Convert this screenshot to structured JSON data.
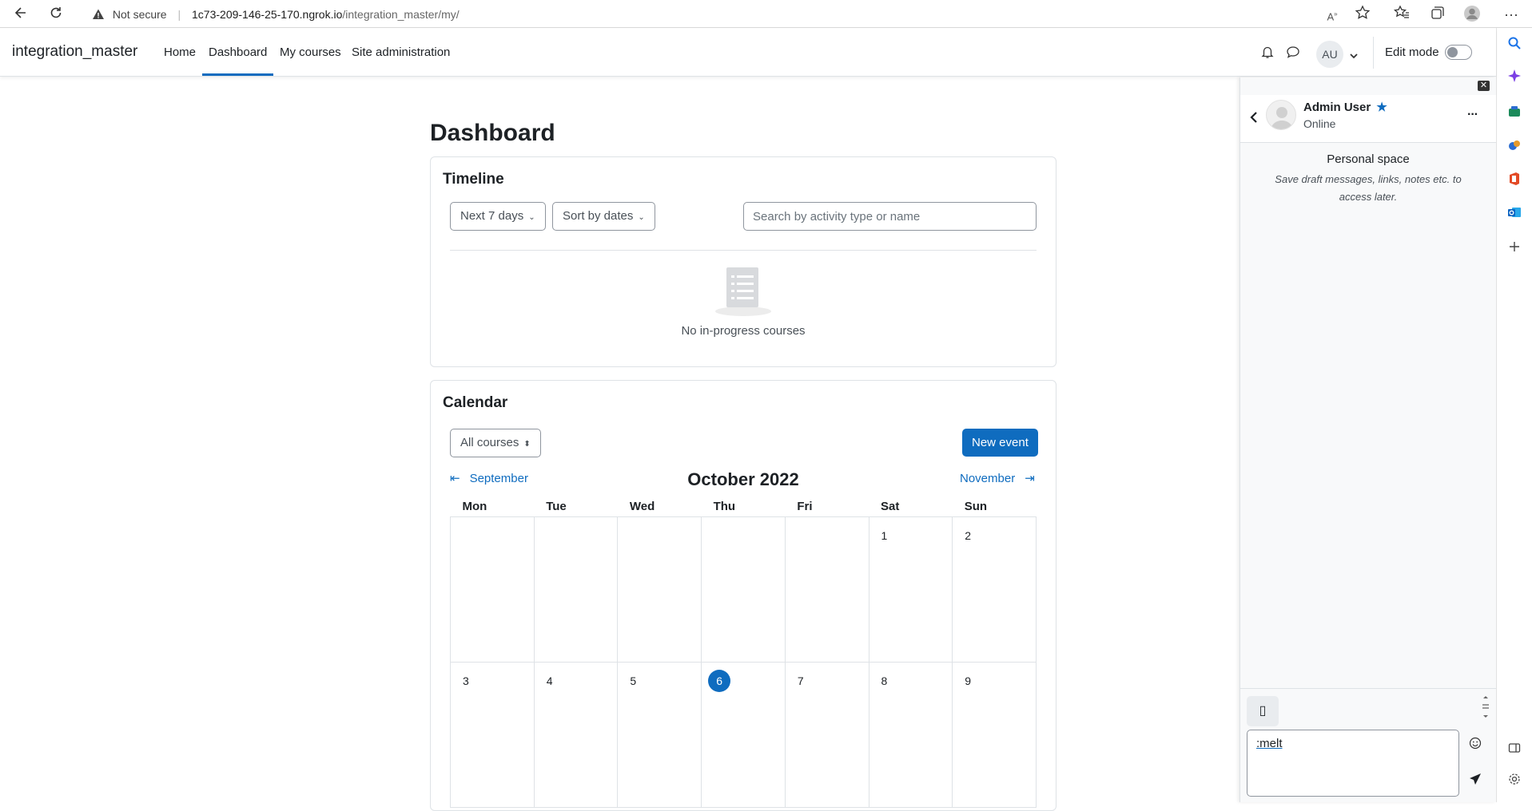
{
  "browser": {
    "not_secure": "Not secure",
    "url_host": "1c73-209-146-25-170.ngrok.io",
    "url_path": "/integration_master/my/"
  },
  "navbar": {
    "brand": "integration_master",
    "links": [
      "Home",
      "Dashboard",
      "My courses",
      "Site administration"
    ],
    "avatar_initials": "AU",
    "edit_mode_label": "Edit mode"
  },
  "main": {
    "page_title": "Dashboard",
    "timeline": {
      "title": "Timeline",
      "filter_label": "Next 7 days",
      "sort_label": "Sort by dates",
      "search_placeholder": "Search by activity type or name",
      "empty_text": "No in-progress courses"
    },
    "calendar": {
      "title": "Calendar",
      "course_select": "All courses",
      "new_event_label": "New event",
      "prev_month": "September",
      "next_month": "November",
      "month_title": "October 2022",
      "weekdays": [
        "Mon",
        "Tue",
        "Wed",
        "Thu",
        "Fri",
        "Sat",
        "Sun"
      ],
      "week1": [
        "",
        "",
        "",
        "",
        "",
        "1",
        "2"
      ],
      "week2": [
        "3",
        "4",
        "5",
        "6",
        "7",
        "8",
        "9"
      ],
      "today": "6"
    }
  },
  "drawer": {
    "user_name": "Admin User",
    "user_status": "Online",
    "space_title": "Personal space",
    "space_desc": "Save draft messages, links, notes etc. to access later.",
    "message_value": ":melt"
  },
  "colors": {
    "primary": "#0f6cbf",
    "border": "#dee2e6"
  }
}
